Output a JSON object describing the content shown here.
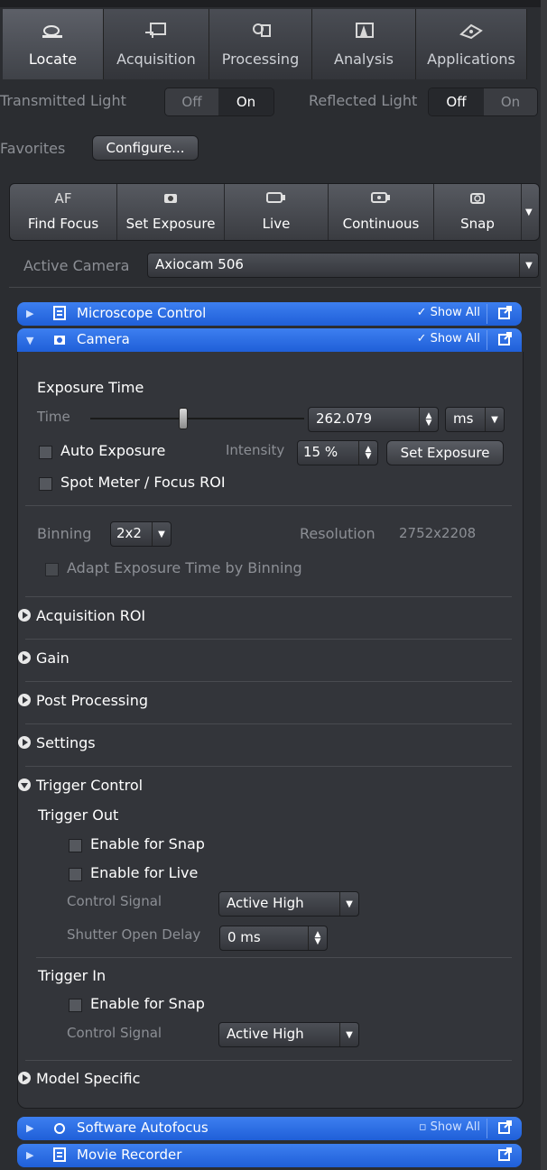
{
  "tabs": [
    {
      "label": "Locate",
      "active": true
    },
    {
      "label": "Acquisition",
      "active": false
    },
    {
      "label": "Processing",
      "active": false
    },
    {
      "label": "Analysis",
      "active": false
    },
    {
      "label": "Applications",
      "active": false
    }
  ],
  "light": {
    "transmitted_label": "Transmitted Light",
    "transmitted_off": "Off",
    "transmitted_on": "On",
    "transmitted_selected": "On",
    "reflected_label": "Reflected Light",
    "reflected_off": "Off",
    "reflected_on": "On",
    "reflected_selected": "Off"
  },
  "favorites": {
    "label": "Favorites",
    "configure": "Configure..."
  },
  "toolbar": [
    {
      "label": "Find Focus",
      "icon": "AF"
    },
    {
      "label": "Set Exposure",
      "icon": "camera-icon"
    },
    {
      "label": "Live",
      "icon": "live-icon"
    },
    {
      "label": "Continuous",
      "icon": "continuous-icon"
    },
    {
      "label": "Snap",
      "icon": "snap-icon"
    }
  ],
  "active_camera": {
    "label": "Active Camera",
    "value": "Axiocam 506"
  },
  "groups": {
    "microscope": "Microscope Control",
    "camera": "Camera",
    "show_all": "Show All",
    "autofocus": "Software Autofocus",
    "movie": "Movie Recorder"
  },
  "exposure": {
    "heading": "Exposure Time",
    "time_label": "Time",
    "time_value": "262.079",
    "unit": "ms",
    "slider_fraction": 0.43,
    "auto_exposure": "Auto Exposure",
    "intensity_label": "Intensity",
    "intensity_value": "15 %",
    "set_exposure": "Set Exposure",
    "spot_meter": "Spot Meter / Focus ROI"
  },
  "binning": {
    "label": "Binning",
    "value": "2x2",
    "resolution_label": "Resolution",
    "resolution_value": "2752x2208",
    "adapt": "Adapt Exposure Time by Binning"
  },
  "sections": {
    "acq_roi": "Acquisition ROI",
    "gain": "Gain",
    "post": "Post Processing",
    "settings": "Settings",
    "trigger": "Trigger Control",
    "model": "Model Specific"
  },
  "trigger": {
    "out_heading": "Trigger Out",
    "out_snap": "Enable for Snap",
    "out_live": "Enable for Live",
    "control_signal_label": "Control Signal",
    "control_signal_value": "Active High",
    "shutter_label": "Shutter Open Delay",
    "shutter_value": "0 ms",
    "in_heading": "Trigger In",
    "in_snap": "Enable for Snap",
    "in_control_label": "Control Signal",
    "in_control_value": "Active High"
  },
  "colors": {
    "accent": "#2f6fe6",
    "panel": "#33353a",
    "background": "#2b2d31"
  }
}
